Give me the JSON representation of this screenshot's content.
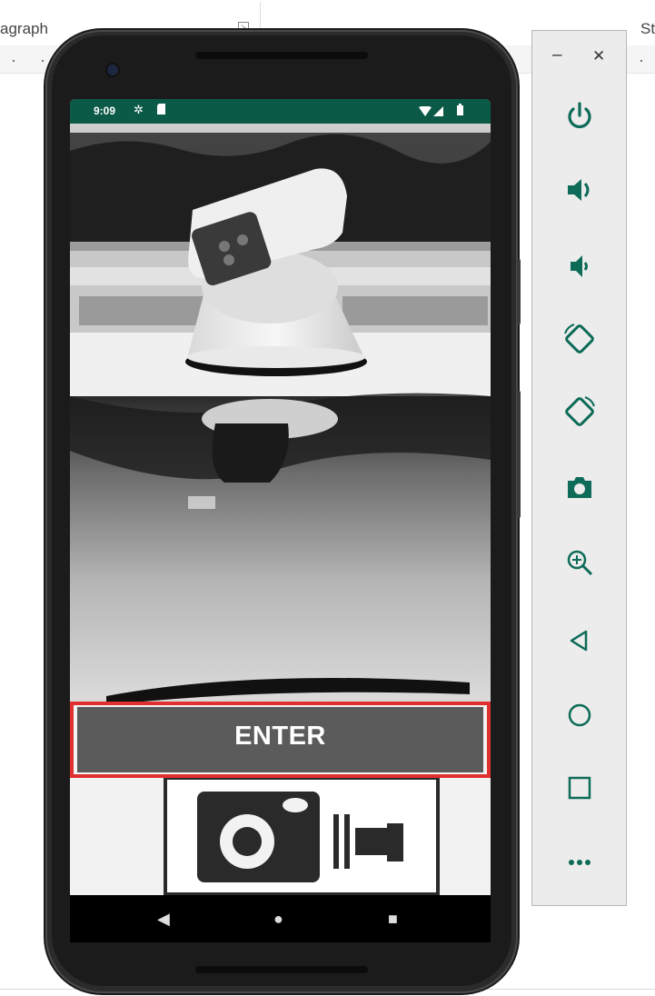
{
  "window": {
    "ribbon_left_label": "agraph",
    "ribbon_right_label": "St",
    "launcher_glyph": "↘"
  },
  "phone": {
    "status": {
      "time": "9:09",
      "left_icons": [
        "settings-icon",
        "sd-card-icon"
      ],
      "right_icons": [
        "wifi-icon",
        "signal-icon",
        "battery-icon"
      ],
      "bar_color": "#0b5a47"
    },
    "app": {
      "background_image": "security camera on car roof with speed camera sign (grayscale photo)",
      "enter_button_label": "ENTER",
      "highlight_color": "#e03030"
    },
    "navbar": {
      "back_glyph": "◀",
      "home_glyph": "●",
      "recents_glyph": "■"
    }
  },
  "emulator_toolbar": {
    "minimize_glyph": "–",
    "close_glyph": "✕",
    "buttons": [
      "power-icon",
      "volume-up-icon",
      "volume-down-icon",
      "rotate-left-icon",
      "rotate-right-icon",
      "screenshot-icon",
      "zoom-icon",
      "back-icon",
      "home-icon",
      "overview-icon",
      "more-icon"
    ]
  }
}
